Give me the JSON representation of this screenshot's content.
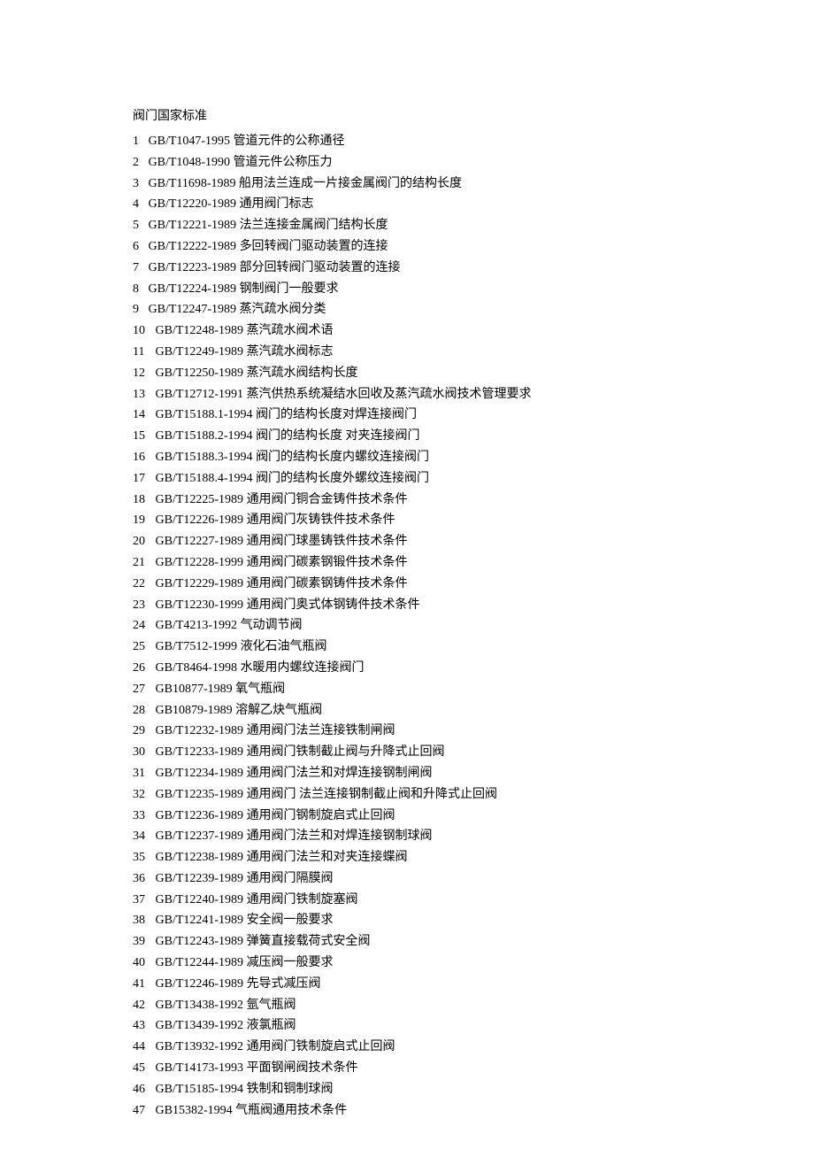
{
  "title": "阀门国家标准",
  "items": [
    {
      "num": "1",
      "code": "GB/T1047-1995",
      "desc": "管道元件的公称通径"
    },
    {
      "num": "2",
      "code": "GB/T1048-1990",
      "desc": "管道元件公称压力"
    },
    {
      "num": "3",
      "code": "GB/T11698-1989",
      "desc": "船用法兰连成一片接金属阀门的结构长度"
    },
    {
      "num": "4",
      "code": "GB/T12220-1989",
      "desc": "通用阀门标志"
    },
    {
      "num": "5",
      "code": "GB/T12221-1989",
      "desc": "法兰连接金属阀门结构长度"
    },
    {
      "num": "6",
      "code": "GB/T12222-1989",
      "desc": "多回转阀门驱动装置的连接"
    },
    {
      "num": "7",
      "code": "GB/T12223-1989",
      "desc": "部分回转阀门驱动装置的连接"
    },
    {
      "num": "8",
      "code": "GB/T12224-1989",
      "desc": "钢制阀门一般要求"
    },
    {
      "num": "9",
      "code": "GB/T12247-1989",
      "desc": "蒸汽疏水阀分类"
    },
    {
      "num": "10",
      "code": "GB/T12248-1989",
      "desc": "蒸汽疏水阀术语"
    },
    {
      "num": "11",
      "code": "GB/T12249-1989",
      "desc": "蒸汽疏水阀标志"
    },
    {
      "num": "12",
      "code": "GB/T12250-1989",
      "desc": "蒸汽疏水阀结构长度"
    },
    {
      "num": "13",
      "code": "GB/T12712-1991",
      "desc": "蒸汽供热系统凝结水回收及蒸汽疏水阀技术管理要求"
    },
    {
      "num": "14",
      "code": "GB/T15188.1-1994",
      "desc": "阀门的结构长度对焊连接阀门"
    },
    {
      "num": "15",
      "code": "GB/T15188.2-1994",
      "desc": "阀门的结构长度  对夹连接阀门"
    },
    {
      "num": "16",
      "code": "GB/T15188.3-1994",
      "desc": "阀门的结构长度内螺纹连接阀门"
    },
    {
      "num": "17",
      "code": "GB/T15188.4-1994",
      "desc": "阀门的结构长度外螺纹连接阀门"
    },
    {
      "num": "18",
      "code": "GB/T12225-1989",
      "desc": "通用阀门铜合金铸件技术条件"
    },
    {
      "num": "19",
      "code": "GB/T12226-1989",
      "desc": "通用阀门灰铸铁件技术条件"
    },
    {
      "num": "20",
      "code": "GB/T12227-1989",
      "desc": "通用阀门球墨铸铁件技术条件"
    },
    {
      "num": "21",
      "code": "GB/T12228-1999",
      "desc": "通用阀门碳素钢锻件技术条件"
    },
    {
      "num": "22",
      "code": "GB/T12229-1989",
      "desc": "通用阀门碳素钢铸件技术条件"
    },
    {
      "num": "23",
      "code": "GB/T12230-1999",
      "desc": "通用阀门奥式体钢铸件技术条件"
    },
    {
      "num": "24",
      "code": "GB/T4213-1992",
      "desc": "气动调节阀"
    },
    {
      "num": "25",
      "code": "GB/T7512-1999",
      "desc": "液化石油气瓶阀"
    },
    {
      "num": "26",
      "code": "GB/T8464-1998",
      "desc": "水暖用内螺纹连接阀门"
    },
    {
      "num": "27",
      "code": "GB10877-1989",
      "desc": "氧气瓶阀"
    },
    {
      "num": "28",
      "code": "GB10879-1989",
      "desc": "溶解乙炔气瓶阀"
    },
    {
      "num": "29",
      "code": "GB/T12232-1989",
      "desc": "通用阀门法兰连接铁制闸阀"
    },
    {
      "num": "30",
      "code": "GB/T12233-1989",
      "desc": "通用阀门铁制截止阀与升降式止回阀"
    },
    {
      "num": "31",
      "code": "GB/T12234-1989",
      "desc": "通用阀门法兰和对焊连接钢制闸阀"
    },
    {
      "num": "32",
      "code": "GB/T12235-1989",
      "desc": "通用阀门  法兰连接钢制截止阀和升降式止回阀"
    },
    {
      "num": "33",
      "code": "GB/T12236-1989",
      "desc": "通用阀门钢制旋启式止回阀"
    },
    {
      "num": "34",
      "code": "GB/T12237-1989",
      "desc": "通用阀门法兰和对焊连接钢制球阀"
    },
    {
      "num": "35",
      "code": "GB/T12238-1989",
      "desc": "通用阀门法兰和对夹连接蝶阀"
    },
    {
      "num": "36",
      "code": "GB/T12239-1989",
      "desc": "通用阀门隔膜阀"
    },
    {
      "num": "37",
      "code": "GB/T12240-1989",
      "desc": "通用阀门铁制旋塞阀"
    },
    {
      "num": "38",
      "code": "GB/T12241-1989",
      "desc": "安全阀一般要求"
    },
    {
      "num": "39",
      "code": "GB/T12243-1989",
      "desc": "弹簧直接载荷式安全阀"
    },
    {
      "num": "40",
      "code": "GB/T12244-1989",
      "desc": "减压阀一般要求"
    },
    {
      "num": "41",
      "code": "GB/T12246-1989",
      "desc": "先导式减压阀"
    },
    {
      "num": "42",
      "code": "GB/T13438-1992",
      "desc": "氩气瓶阀"
    },
    {
      "num": "43",
      "code": "GB/T13439-1992",
      "desc": "液氯瓶阀"
    },
    {
      "num": "44",
      "code": "GB/T13932-1992",
      "desc": "通用阀门铁制旋启式止回阀"
    },
    {
      "num": "45",
      "code": "GB/T14173-1993",
      "desc": "平面钢闸阀技术条件"
    },
    {
      "num": "46",
      "code": "GB/T15185-1994",
      "desc": "铁制和铜制球阀"
    },
    {
      "num": "47",
      "code": "GB15382-1994",
      "desc": "气瓶阀通用技术条件"
    }
  ]
}
